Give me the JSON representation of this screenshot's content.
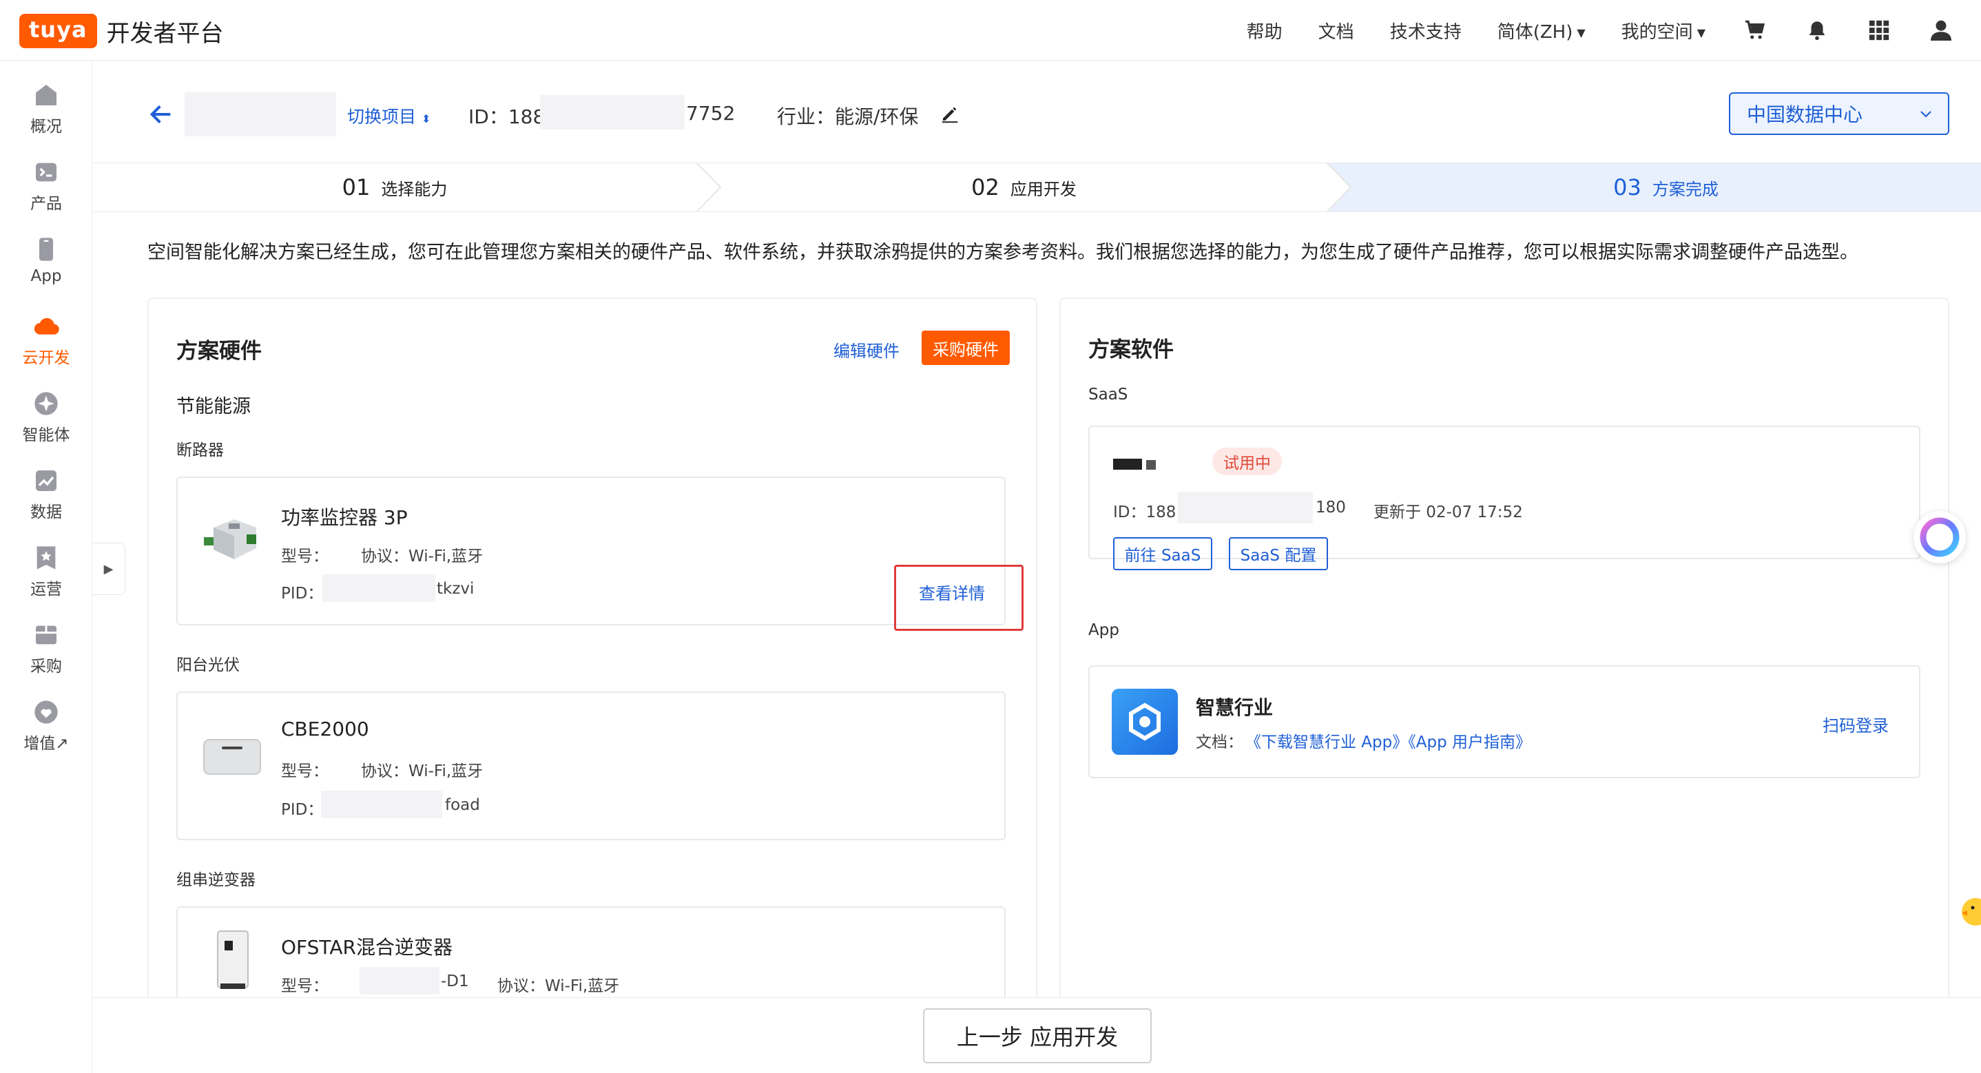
{
  "brand": {
    "logo_mark": "tuya",
    "platform_name": "开发者平台",
    "color": "#ff5a00"
  },
  "topnav": {
    "help": "帮助",
    "docs": "文档",
    "tech_support": "技术支持",
    "language": "简体(ZH)",
    "my_space": "我的空间",
    "icons": [
      "cart-icon",
      "bell-icon",
      "apps-grid-icon",
      "user-icon"
    ]
  },
  "sidebar": {
    "items": [
      {
        "label": "概况",
        "icon": "home-icon"
      },
      {
        "label": "产品",
        "icon": "terminal-icon"
      },
      {
        "label": "App",
        "icon": "phone-icon"
      },
      {
        "label": "云开发",
        "icon": "cloud-icon",
        "active": true
      },
      {
        "label": "智能体",
        "icon": "agent-icon"
      },
      {
        "label": "数据",
        "icon": "chart-icon"
      },
      {
        "label": "运营",
        "icon": "star-badge-icon"
      },
      {
        "label": "采购",
        "icon": "box-icon"
      },
      {
        "label": "增值↗",
        "icon": "heart-icon"
      }
    ]
  },
  "header": {
    "switch_project": "切换项目",
    "id_label": "ID：188",
    "id_tail": "7752",
    "industry": "行业：能源/环保",
    "data_center": "中国数据中心"
  },
  "steps": [
    {
      "num": "01",
      "label": "选择能力"
    },
    {
      "num": "02",
      "label": "应用开发"
    },
    {
      "num": "03",
      "label": "方案完成",
      "active": true
    }
  ],
  "description": "空间智能化解决方案已经生成，您可在此管理您方案相关的硬件产品、软件系统，并获取涂鸦提供的方案参考资料。我们根据您选择的能力，为您生成了硬件产品推荐，您可以根据实际需求调整硬件产品选型。",
  "hardware": {
    "title": "方案硬件",
    "edit": "编辑硬件",
    "purchase": "采购硬件",
    "category": "节能能源",
    "groups": [
      {
        "name": "断路器",
        "product": {
          "name": "功率监控器 3P",
          "model_label": "型号：",
          "model_tail": "",
          "protocol": "协议：Wi-Fi,蓝牙",
          "pid_label": "PID：",
          "pid_tail": "tkzvi",
          "detail": "查看详情"
        }
      },
      {
        "name": "阳台光伏",
        "product": {
          "name": "CBE2000",
          "model_label": "型号：",
          "model_tail": "",
          "protocol": "协议：Wi-Fi,蓝牙",
          "pid_label": "PID：",
          "pid_tail": "foad"
        }
      },
      {
        "name": "组串逆变器",
        "product": {
          "name": "OFSTAR混合逆变器",
          "model_label": "型号：",
          "model_tail": "-D1",
          "protocol": "协议：Wi-Fi,蓝牙"
        }
      }
    ]
  },
  "software": {
    "title": "方案软件",
    "saas": {
      "section": "SaaS",
      "tag": "试用中",
      "id_label": "ID：188",
      "id_tail": "180",
      "updated": "更新于 02-07 17:52",
      "goto": "前往 SaaS",
      "config": "SaaS 配置"
    },
    "app": {
      "section": "App",
      "name": "智慧行业",
      "docs_label": "文档：",
      "doc_links": "《下载智慧行业 App》《App 用户指南》",
      "scan_login": "扫码登录"
    }
  },
  "footer": {
    "prev_step": "上一步 应用开发"
  }
}
